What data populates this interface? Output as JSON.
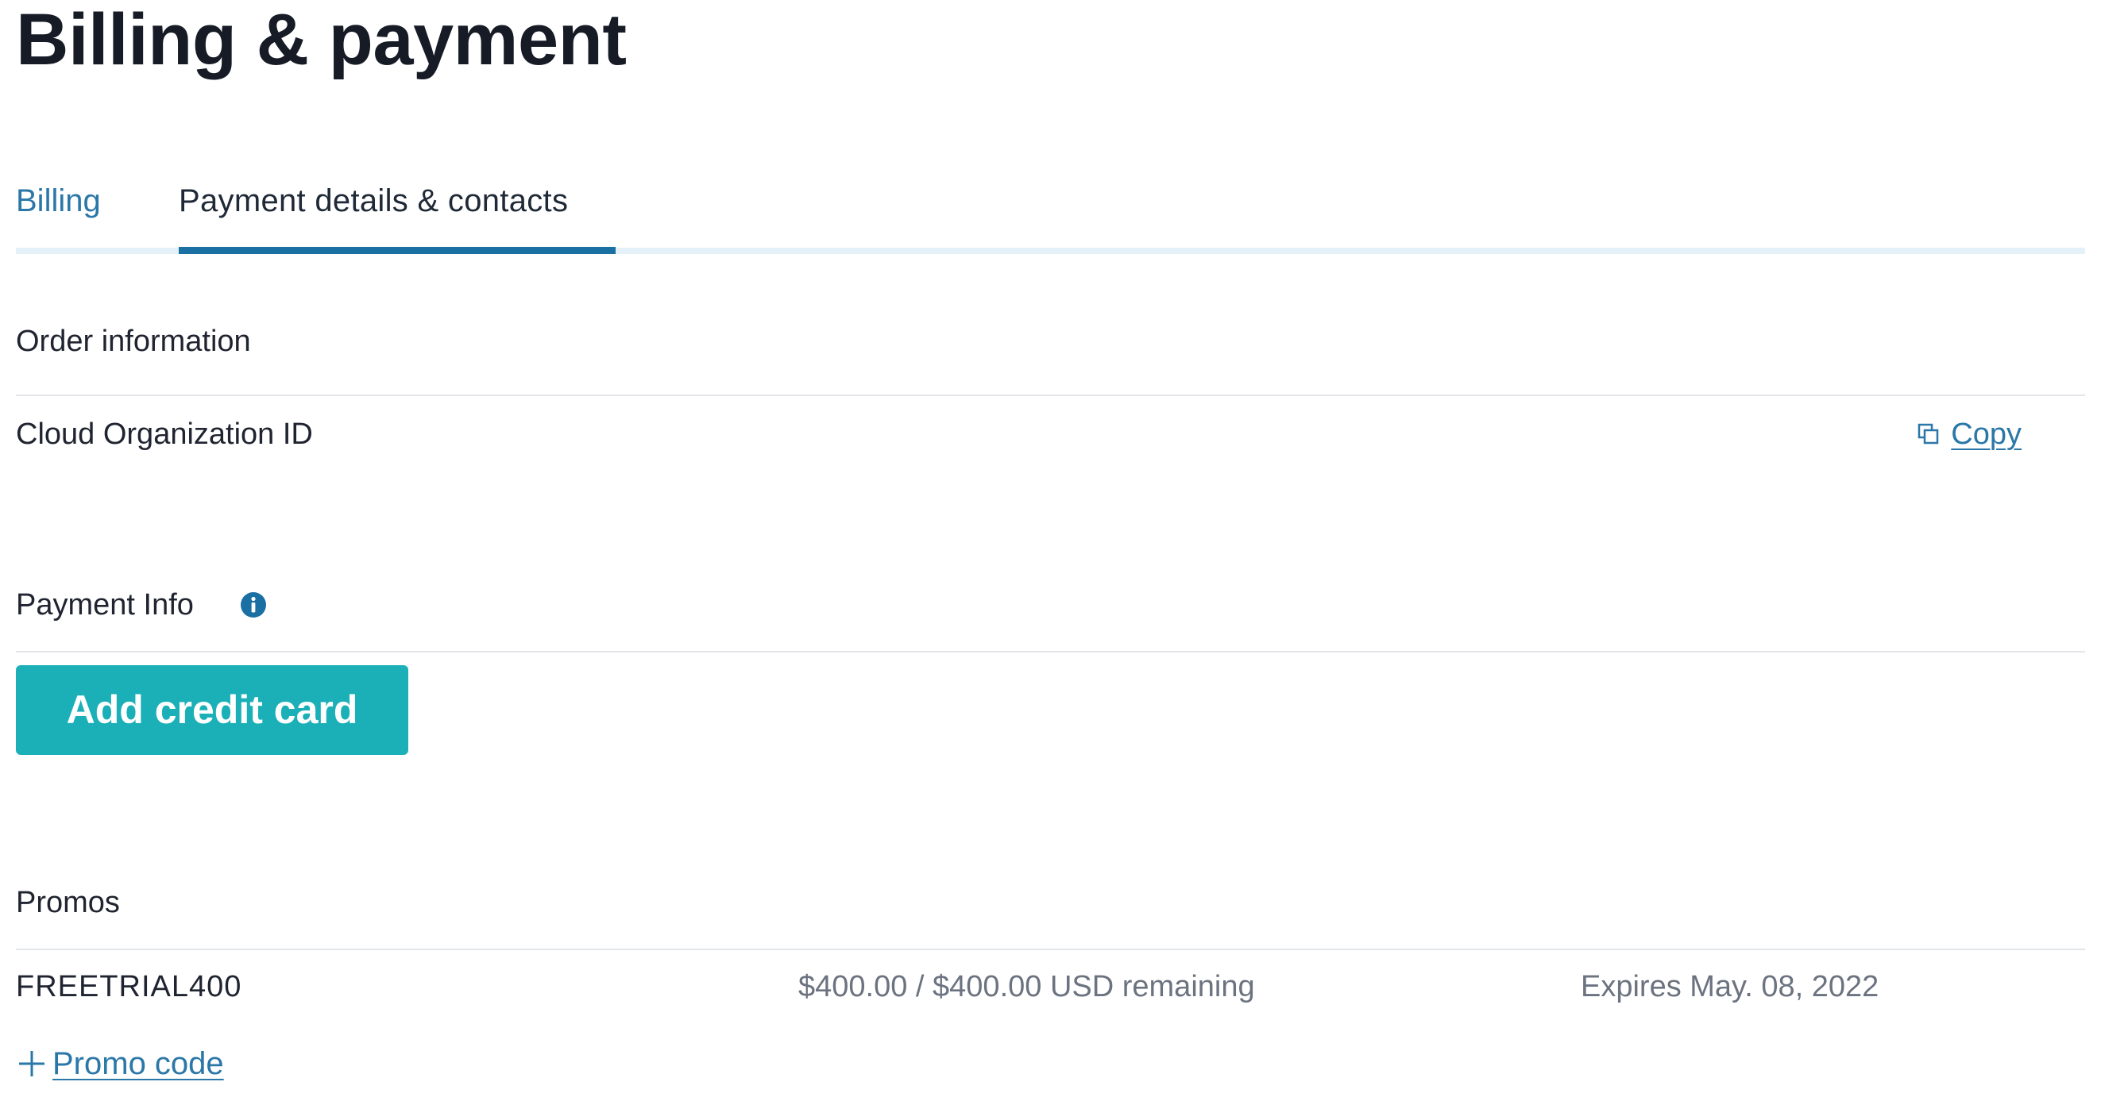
{
  "page": {
    "title": "Billing & payment"
  },
  "tabs": [
    {
      "label": "Billing",
      "active": false
    },
    {
      "label": "Payment details & contacts",
      "active": true
    }
  ],
  "order_information": {
    "heading": "Order information",
    "cloud_org_label": "Cloud Organization ID",
    "copy_label": "Copy"
  },
  "payment_info": {
    "heading": "Payment Info",
    "add_card_label": "Add credit card"
  },
  "promos": {
    "heading": "Promos",
    "items": [
      {
        "code": "FREETRIAL400",
        "remaining": "$400.00 / $400.00 USD remaining",
        "expires": "Expires May. 08, 2022"
      }
    ],
    "add_promo_label": "Promo code"
  },
  "icons": {
    "copy": "copy-icon",
    "info": "info-icon",
    "plus": "plus-icon"
  },
  "colors": {
    "link": "#2a77a8",
    "tab_active": "#1a6fa3",
    "button": "#1bb0b8",
    "muted_text": "#6c7380"
  }
}
